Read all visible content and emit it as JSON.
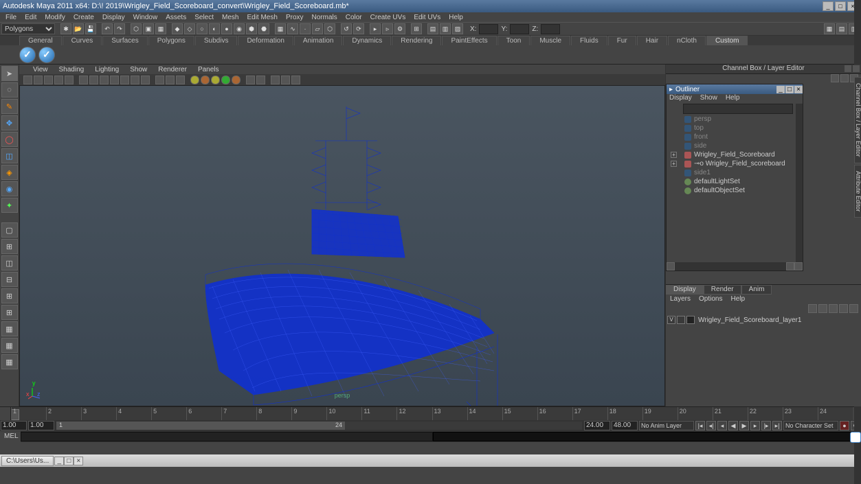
{
  "title": "Autodesk Maya 2011 x64: D:\\! 2019\\Wrigley_Field_Scoreboard_convert\\Wrigley_Field_Scoreboard.mb*",
  "menus": [
    "File",
    "Edit",
    "Modify",
    "Create",
    "Display",
    "Window",
    "Assets",
    "Select",
    "Mesh",
    "Edit Mesh",
    "Proxy",
    "Normals",
    "Color",
    "Create UVs",
    "Edit UVs",
    "Help"
  ],
  "mode_selector": "Polygons",
  "coords": {
    "x": "X:",
    "y": "Y:",
    "z": "Z:"
  },
  "shelf_tabs": [
    "General",
    "Curves",
    "Surfaces",
    "Polygons",
    "Subdivs",
    "Deformation",
    "Animation",
    "Dynamics",
    "Rendering",
    "PaintEffects",
    "Toon",
    "Muscle",
    "Fluids",
    "Fur",
    "Hair",
    "nCloth",
    "Custom"
  ],
  "active_shelf_tab": "Custom",
  "panel_menus": [
    "View",
    "Shading",
    "Lighting",
    "Show",
    "Renderer",
    "Panels"
  ],
  "camera_label": "persp",
  "axis": {
    "x": "x",
    "y": "y",
    "z": "z"
  },
  "channel_box_title": "Channel Box / Layer Editor",
  "outliner": {
    "title": "Outliner",
    "menus": [
      "Display",
      "Show",
      "Help"
    ],
    "items": [
      {
        "name": "persp",
        "type": "cam",
        "bright": false
      },
      {
        "name": "top",
        "type": "cam",
        "bright": false
      },
      {
        "name": "front",
        "type": "cam",
        "bright": false
      },
      {
        "name": "side",
        "type": "cam",
        "bright": false
      },
      {
        "name": "Wrigley_Field_Scoreboard",
        "type": "mesh",
        "bright": true,
        "expand": true
      },
      {
        "name": "⊸o Wrigley_Field_scoreboard",
        "type": "mesh",
        "bright": true,
        "expand": true,
        "indent": true
      },
      {
        "name": "side1",
        "type": "cam",
        "bright": false
      },
      {
        "name": "defaultLightSet",
        "type": "set",
        "bright": true
      },
      {
        "name": "defaultObjectSet",
        "type": "set",
        "bright": true
      }
    ]
  },
  "layer_tabs": [
    "Display",
    "Render",
    "Anim"
  ],
  "active_layer_tab": "Display",
  "layer_menus": [
    "Layers",
    "Options",
    "Help"
  ],
  "layer_row": {
    "vis": "V",
    "name": "Wrigley_Field_Scoreboard_layer1"
  },
  "timeline_ticks": [
    "1",
    "2",
    "3",
    "4",
    "5",
    "6",
    "7",
    "8",
    "9",
    "10",
    "11",
    "12",
    "13",
    "14",
    "15",
    "16",
    "17",
    "18",
    "19",
    "20",
    "21",
    "22",
    "23",
    "24"
  ],
  "range": {
    "start_outer": "1.00",
    "start_inner": "1.00",
    "slider_start": "1",
    "slider_end": "24",
    "end_inner": "24.00",
    "end_outer": "48.00"
  },
  "playback": {
    "anim_layer": "No Anim Layer",
    "char_set": "No Character Set"
  },
  "cmd_label": "MEL",
  "taskbar_item": "C:\\Users\\Us...",
  "right_tabs": [
    "Channel Box / Layer Editor",
    "Attribute Editor"
  ]
}
